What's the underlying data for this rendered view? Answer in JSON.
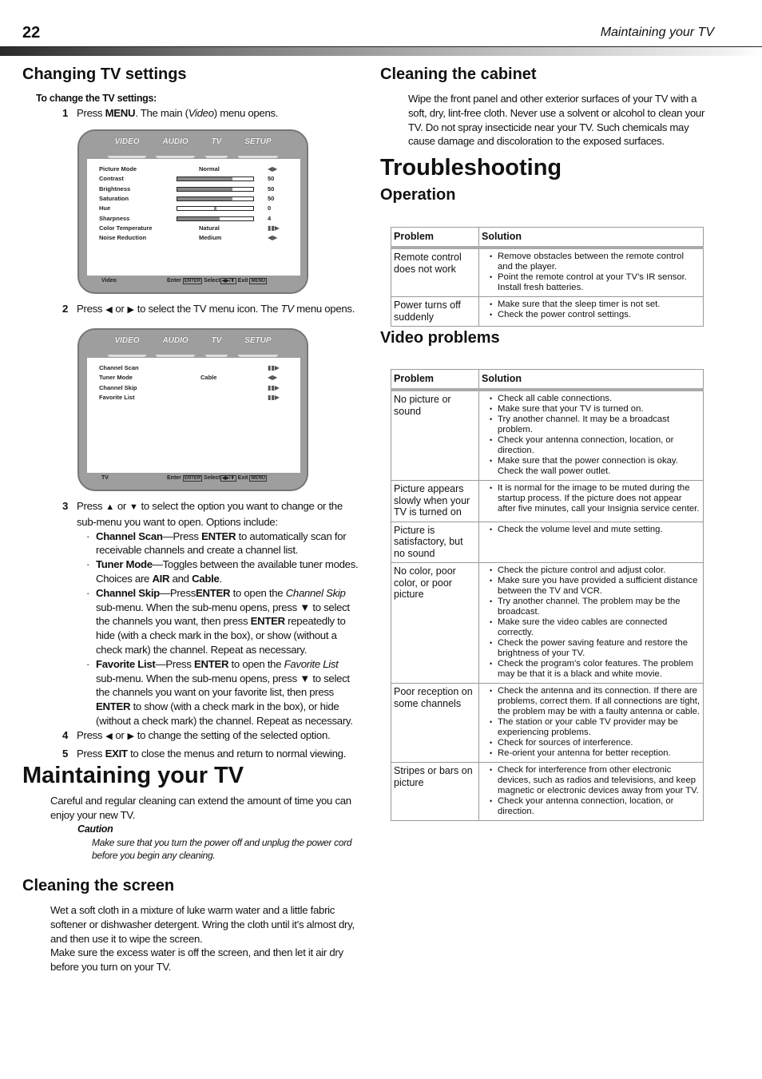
{
  "header": {
    "page_number": "22",
    "running_title": "Maintaining your TV"
  },
  "changing": {
    "heading": "Changing TV settings",
    "procedure_title": "To change the TV settings:",
    "step1": {
      "num": "1",
      "pre": "Press ",
      "key": "MENU",
      "mid": ". The main (",
      "em": "Video",
      "post": ") menu opens."
    },
    "step2": {
      "num": "2",
      "pre": "Press",
      "or": "or",
      "post": "to select the TV menu icon. The ",
      "em": "TV",
      "post2": " menu opens."
    },
    "step3": {
      "num": "3",
      "pre": "Press",
      "or": "or",
      "post": "to select the option you want to change or the sub-menu you want to open. Options include:"
    },
    "options": [
      {
        "term": "Channel Scan",
        "text1": "—Press ",
        "key": "ENTER",
        "text2": " to automatically scan for receivable channels and create a channel list."
      },
      {
        "term": "Tuner Mode",
        "text1": "—Toggles between the available tuner modes. Choices are ",
        "key": "AIR",
        "text2": " and ",
        "key2": "Cable",
        "text3": "."
      },
      {
        "term": "Channel Skip",
        "text1": "—Press",
        "key": "ENTER",
        "text2": " to open the ",
        "em": "Channel Skip",
        "text3": " sub-menu. When the sub-menu opens, press ▼ to select the channels you want, then press ",
        "key2": "ENTER",
        "text4": " repeatedly to hide (with a check mark in the box), or show (without a check mark) the channel. Repeat as necessary."
      },
      {
        "term": "Favorite List",
        "text1": "—Press ",
        "key": "ENTER",
        "text2": " to open the ",
        "em": "Favorite List",
        "text3": " sub-menu. When the sub-menu opens, press ▼ to select the channels you want on your favorite list, then press ",
        "key2": "ENTER",
        "text4": " to show (with a check mark in the box), or hide (without a check mark) the channel. Repeat as necessary."
      }
    ],
    "step4": {
      "num": "4",
      "pre": "Press",
      "or": "or",
      "post": "to change the setting of the selected option."
    },
    "step5": {
      "num": "5",
      "pre": "Press ",
      "key": "EXIT",
      "post": " to close the menus and return to normal viewing."
    }
  },
  "tv_menu_tabs": [
    "VIDEO",
    "AUDIO",
    "TV",
    "SETUP"
  ],
  "video_menu": {
    "rows": [
      {
        "label": "Picture Mode",
        "value": "Normal",
        "indicator": "◀▶"
      },
      {
        "label": "Contrast",
        "level": 0.73,
        "value": "50"
      },
      {
        "label": "Brightness",
        "level": 0.73,
        "value": "50"
      },
      {
        "label": "Saturation",
        "level": 0.73,
        "value": "50"
      },
      {
        "label": "Hue",
        "level": 0.5,
        "value": "0"
      },
      {
        "label": "Sharpness",
        "level": 0.56,
        "value": "4"
      },
      {
        "label": "Color Temperature",
        "value": "Natural",
        "indicator": "▮▮▶"
      },
      {
        "label": "Noise Reduction",
        "value": "Medium",
        "indicator": "◀▶"
      }
    ],
    "footer": {
      "name": "Video",
      "enter": "Enter",
      "enter_key": "ENTER",
      "select": "Select",
      "select_key": "◀▶/⬍",
      "exit": "Exit",
      "exit_key": "MENU"
    }
  },
  "tv_menu": {
    "rows": [
      {
        "label": "Channel Scan",
        "value": "",
        "indicator": "▮▮▶"
      },
      {
        "label": "Tuner Mode",
        "value": "Cable",
        "indicator": "◀▶"
      },
      {
        "label": "Channel Skip",
        "value": "",
        "indicator": "▮▮▶"
      },
      {
        "label": "Favorite List",
        "value": "",
        "indicator": "▮▮▶"
      }
    ],
    "footer": {
      "name": "TV",
      "enter": "Enter",
      "enter_key": "ENTER",
      "select": "Select",
      "select_key": "◀▶/⬍",
      "exit": "Exit",
      "exit_key": "MENU"
    }
  },
  "maintaining": {
    "heading": "Maintaining your TV",
    "intro": "Careful and regular cleaning can extend the amount of time you can enjoy your new TV.",
    "caution_title": "Caution",
    "caution_text": "Make sure that you turn the power off and unplug the power cord before you begin any cleaning."
  },
  "screen": {
    "heading": "Cleaning the screen",
    "p1": "Wet a soft cloth in a mixture of luke warm water and a little fabric softener or dishwasher detergent. Wring the cloth until it’s almost dry, and then use it to wipe the screen.",
    "p2": "Make sure the excess water is off the screen, and then let it air dry before you turn on your TV."
  },
  "cabinet": {
    "heading": "Cleaning the cabinet",
    "p1": "Wipe the front panel and other exterior surfaces of your TV with a soft, dry, lint-free cloth. Never use a solvent or alcohol to clean your TV. Do not spray insecticide near your TV. Such chemicals may cause damage and discoloration to the exposed surfaces."
  },
  "troubleshooting": {
    "heading": "Troubleshooting",
    "col_problem": "Problem",
    "col_solution": "Solution",
    "operation": {
      "heading": "Operation",
      "rows": [
        {
          "problem": "Remote control does not work",
          "solutions": [
            "Remove obstacles between the remote control and the player.",
            "Point the remote control at your TV’s IR sensor. Install fresh batteries."
          ]
        },
        {
          "problem": "Power turns off suddenly",
          "solutions": [
            "Make sure that the sleep timer is not set.",
            "Check the power control settings."
          ]
        }
      ]
    },
    "video": {
      "heading": "Video problems",
      "rows": [
        {
          "problem": "No picture or sound",
          "solutions": [
            "Check all cable connections.",
            "Make sure that your TV is turned on.",
            "Try another channel. It may be a broadcast problem.",
            "Check your antenna connection, location, or direction.",
            "Make sure that the power connection is okay. Check the wall power outlet."
          ]
        },
        {
          "problem": "Picture appears slowly when your TV is turned on",
          "solutions": [
            "It is normal for the image to be muted during the startup process. If the picture does not appear after five minutes, call your Insignia service center."
          ]
        },
        {
          "problem": "Picture is satisfactory, but no sound",
          "solutions": [
            "Check the volume level and mute setting."
          ]
        },
        {
          "problem": "No color, poor color, or poor picture",
          "solutions": [
            "Check the picture control and adjust color.",
            "Make sure you have provided a sufficient distance between the TV and VCR.",
            "Try another channel. The problem may be the broadcast.",
            "Make sure the video cables are connected correctly.",
            "Check the power saving feature and restore the brightness of your TV.",
            "Check the program's color features. The problem may be that it is a black and white movie."
          ]
        },
        {
          "problem": "Poor reception on some channels",
          "solutions": [
            "Check the antenna and its connection. If there are problems, correct them. If all connections are tight, the problem may be with a faulty antenna or cable.",
            "The station or your cable TV provider may be experiencing problems.",
            "Check for sources of interference.",
            "Re-orient your antenna for better reception."
          ]
        },
        {
          "problem": "Stripes or bars on picture",
          "solutions": [
            "Check for interference from other electronic devices, such as radios and televisions, and keep magnetic or electronic devices away from your TV.",
            "Check your antenna connection, location, or direction."
          ]
        }
      ]
    }
  }
}
